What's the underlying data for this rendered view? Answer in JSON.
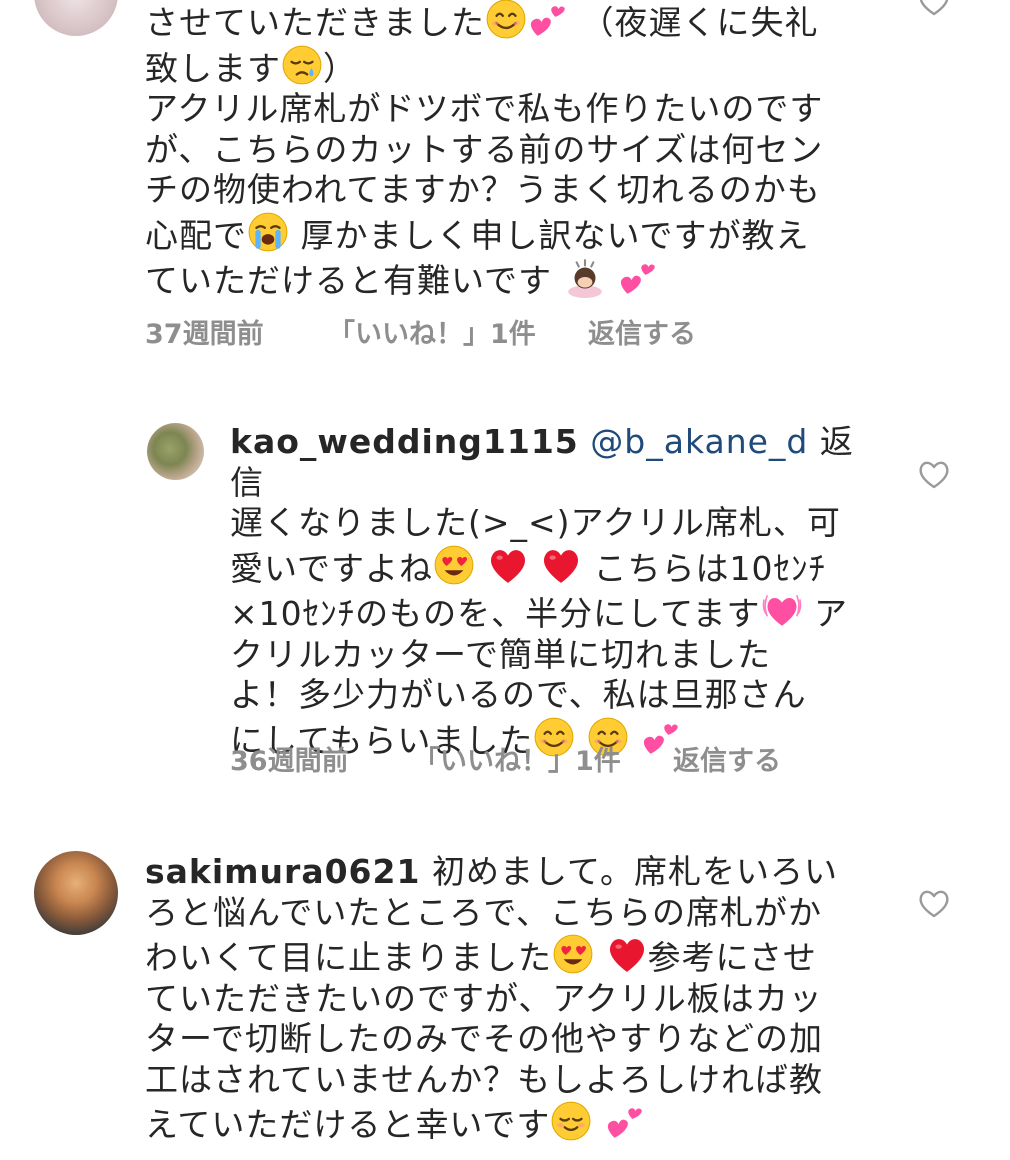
{
  "comments": [
    {
      "username": "",
      "mention": "",
      "lines": [
        "させていただきました",
        "（夜遅くに失礼",
        "致します",
        "）",
        "アクリル席札がドツボで私も作りたいのです",
        "が、こちらのカットする前のサイズは何セン",
        "チの物使われてますか？うまく切れるのかも",
        "心配で",
        "厚かましく申し訳ないですが教え",
        "ていただけると有難いです"
      ],
      "time": "37週間前",
      "likes": "「いいね！」1件",
      "reply": "返信する"
    },
    {
      "username": "kao_wedding1115",
      "mention": "@b_akane_d",
      "lines": [
        "返信",
        "遅くなりました(>_<)アクリル席札、可",
        "愛いですよね",
        "こちらは10ｾﾝﾁ",
        "×10ｾﾝﾁのものを、半分にしてます",
        "ア",
        "クリルカッターで簡単に切れました",
        "よ！多少力がいるので、私は旦那さん",
        "にしてもらいました"
      ],
      "time": "36週間前",
      "likes": "「いいね！」1件",
      "reply": "返信する"
    },
    {
      "username": "sakimura0621",
      "mention": "",
      "lines": [
        "初めまして。席札をいろい",
        "ろと悩んでいたところで、こちらの席札がか",
        "わいくて目に止まりました",
        "参考にさせ",
        "ていただきたいのですが、アクリル板はカッ",
        "ターで切断したのみでその他やすりなどの加",
        "工はされていませんか？もしよろしければ教",
        "えていただけると幸いです"
      ]
    }
  ],
  "colors": {
    "text": "#262626",
    "meta": "#8e8e8e",
    "mention": "#1f4a7a",
    "heart_outline": "#9a9a9a"
  },
  "icons": [
    "heart-outline-icon",
    "smiling-face-icon",
    "two-hearts-icon",
    "sleepy-face-icon",
    "loudly-crying-face-icon",
    "person-bowing-icon",
    "heart-eyes-face-icon",
    "red-heart-icon",
    "beating-heart-icon",
    "relieved-face-icon"
  ]
}
